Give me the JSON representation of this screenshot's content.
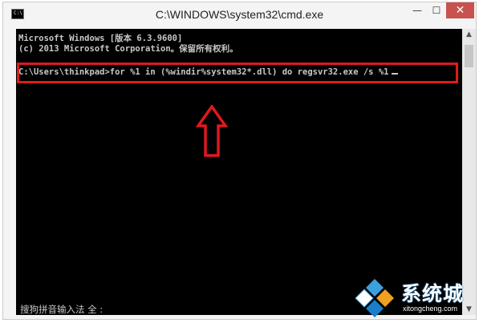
{
  "window": {
    "title": "C:\\WINDOWS\\system32\\cmd.exe",
    "icon_text": "C:\\",
    "controls": {
      "minimize": "—",
      "maximize": "☐",
      "close": "✕"
    }
  },
  "console": {
    "lines": [
      "Microsoft Windows [版本 6.3.9600]",
      "(c) 2013 Microsoft Corporation。保留所有权利。",
      "C:\\Users\\thinkpad>for %1 in (%windir%system32*.dll) do regsvr32.exe /s %1"
    ],
    "ime_status": "搜狗拼音输入法 全 :"
  },
  "annotation": {
    "box_color": "#e0191d",
    "arrow_direction": "up"
  },
  "watermark": {
    "brand": "系统城",
    "url": "xitongcheng.com"
  },
  "icons": [
    "cmd-app-icon",
    "minimize-icon",
    "maximize-icon",
    "close-icon",
    "up-arrow-annotation",
    "xitongcheng-logo-icon"
  ]
}
